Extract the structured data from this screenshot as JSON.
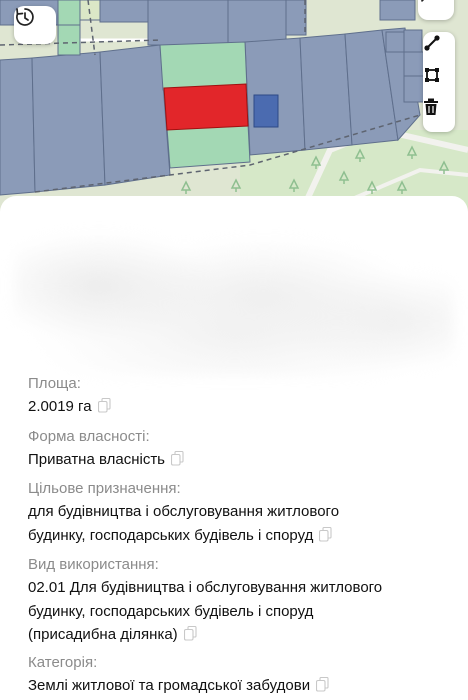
{
  "map": {
    "buttons": {
      "history_icon": "history-refresh-icon",
      "chat_icon": "chat-bubble-icon"
    },
    "tools": [
      "draw-line-icon",
      "draw-polygon-icon",
      "trash-icon"
    ],
    "colors": {
      "selected_parcel": "#e2262a",
      "parcel_fill": "#8b9bb8",
      "parcel_green": "#a3d8b4",
      "highlight_parcel": "#4b6bb0",
      "map_background": "#dfe6d2"
    }
  },
  "details": {
    "area": {
      "label": "Площа:",
      "value": "2.0019 га"
    },
    "ownership": {
      "label": "Форма власності:",
      "value": "Приватна власність"
    },
    "purpose": {
      "label": "Цільове призначення:",
      "line1": "для будівництва і обслуговування житлового",
      "line2": "будинку, господарських будівель і споруд"
    },
    "usage": {
      "label": "Вид використання:",
      "line1": "02.01 Для будівництва і обслуговування житлового",
      "line2": "будинку, господарських будівель і споруд",
      "line3": "(присадибна ділянка)"
    },
    "category": {
      "label": "Категорія:",
      "value": "Землі житлової та громадської забудови"
    }
  }
}
